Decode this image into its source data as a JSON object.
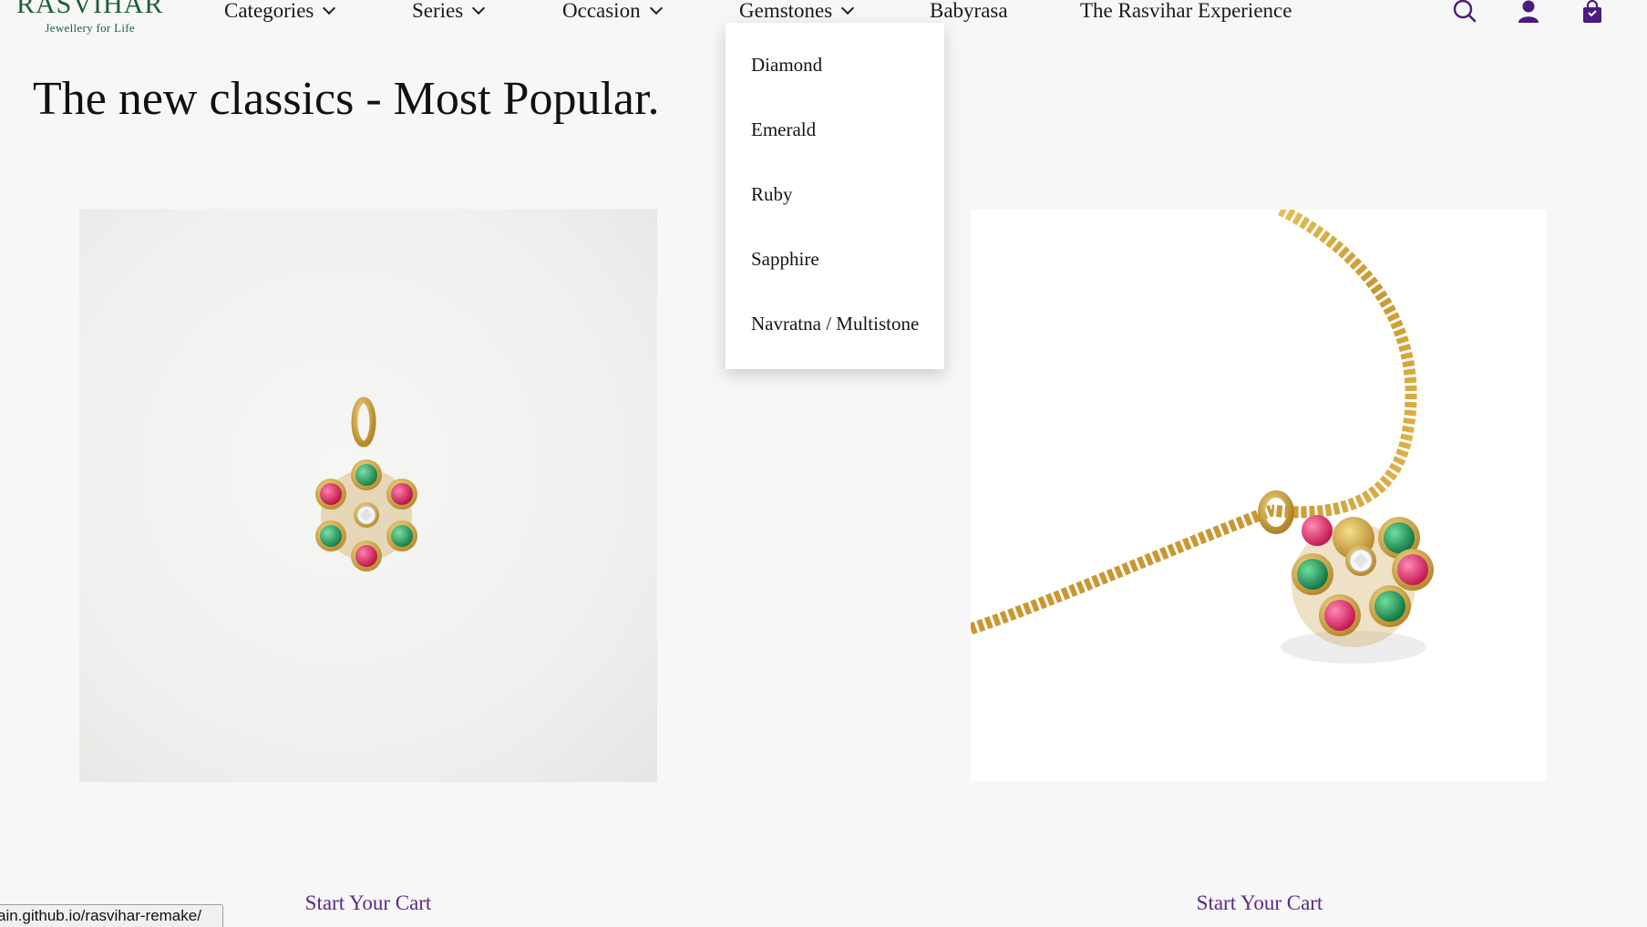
{
  "brand": {
    "name": "RASVIHAR",
    "tagline": "Jewellery for Life",
    "color": "#1f5f3a"
  },
  "nav": {
    "items": [
      {
        "label": "Categories",
        "has_dropdown": true
      },
      {
        "label": "Series",
        "has_dropdown": true
      },
      {
        "label": "Occasion",
        "has_dropdown": true
      },
      {
        "label": "Gemstones",
        "has_dropdown": true
      },
      {
        "label": "Babyrasa",
        "has_dropdown": false
      },
      {
        "label": "The Rasvihar Experience",
        "has_dropdown": false
      }
    ],
    "icons": [
      "search-icon",
      "user-icon",
      "shopping-bag-icon"
    ],
    "icon_color": "#4b1b7e"
  },
  "gemstones_dropdown": {
    "open": true,
    "items": [
      {
        "label": "Diamond"
      },
      {
        "label": "Emerald"
      },
      {
        "label": "Ruby"
      },
      {
        "label": "Sapphire"
      },
      {
        "label": "Navratna / Multistone"
      }
    ]
  },
  "section": {
    "title": "The new classics - Most Popular."
  },
  "products": [
    {
      "image": "flower-pendant-photo",
      "cta_label": "Start Your Cart"
    },
    {
      "image": "flower-pendant-on-chain-photo",
      "cta_label": "Start Your Cart"
    }
  ],
  "cta_color": "#5a2a8a",
  "status_bar": {
    "url": "ain.github.io/rasvihar-remake/"
  }
}
